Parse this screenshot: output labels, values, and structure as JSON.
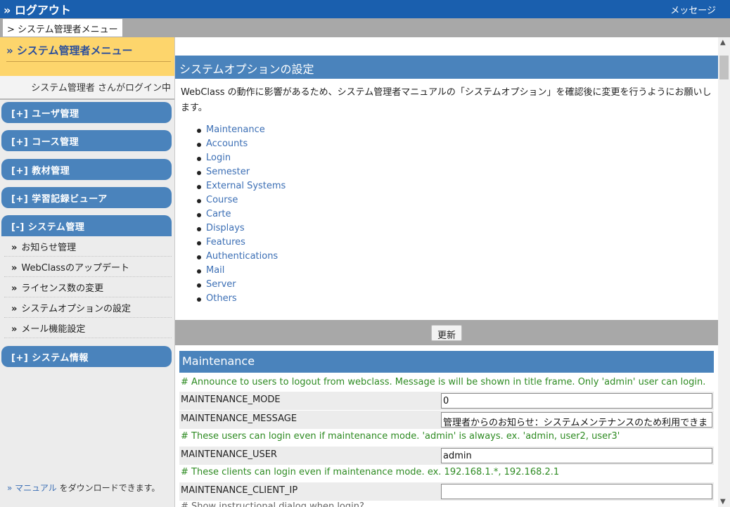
{
  "topbar": {
    "logout": "» ログアウト",
    "message": "メッセージ"
  },
  "breadcrumb": "> システム管理者メニュー",
  "sidebar": {
    "title": "» システム管理者メニュー",
    "login_status": "システム管理者 さんがログイン中",
    "menus": [
      {
        "label": "[+] ユーザ管理"
      },
      {
        "label": "[+] コース管理"
      },
      {
        "label": "[+] 教材管理"
      },
      {
        "label": "[+] 学習記録ビューア"
      },
      {
        "label": "[-] システム管理"
      }
    ],
    "system_items": [
      {
        "label": "お知らせ管理"
      },
      {
        "label": "WebClassのアップデート"
      },
      {
        "label": "ライセンス数の変更"
      },
      {
        "label": "システムオプションの設定"
      },
      {
        "label": "メール機能設定"
      }
    ],
    "info_menu": "[+] システム情報",
    "manual_link": "» マニュアル",
    "manual_suffix": " をダウンロードできます。"
  },
  "main": {
    "title": "システムオプションの設定",
    "intro": "WebClass の動作に影響があるため、システム管理者マニュアルの「システムオプション」を確認後に変更を行うようにお願いします。",
    "links": [
      "Maintenance",
      "Accounts",
      "Login",
      "Semester",
      "External Systems",
      "Course",
      "Carte",
      "Displays",
      "Features",
      "Authentications",
      "Mail",
      "Server",
      "Others"
    ],
    "update_button": "更新",
    "maintenance": {
      "title": "Maintenance",
      "comment1": "# Announce to users to logout from webclass. Message is will be shown in title frame. Only 'admin' user can login.",
      "mode_label": "MAINTENANCE_MODE",
      "mode_value": "0",
      "message_label": "MAINTENANCE_MESSAGE",
      "message_value": "管理者からのお知らせ：システムメンテナンスのため利用できま",
      "comment2": "# These users can login even if maintenance mode. 'admin' is always. ex. 'admin, user2, user3'",
      "user_label": "MAINTENANCE_USER",
      "user_value": "admin",
      "comment3": "# These clients can login even if maintenance mode. ex. 192.168.1.*, 192.168.2.1",
      "client_label": "MAINTENANCE_CLIENT_IP",
      "client_value": "",
      "comment4": "# Show instructional dialog when login?"
    }
  },
  "colors": {
    "topbar": "#1a5fae",
    "accent": "#4a83bc",
    "sidebar_head": "#fdd56c",
    "comment": "#2e8b22",
    "link": "#3c6fb5"
  }
}
